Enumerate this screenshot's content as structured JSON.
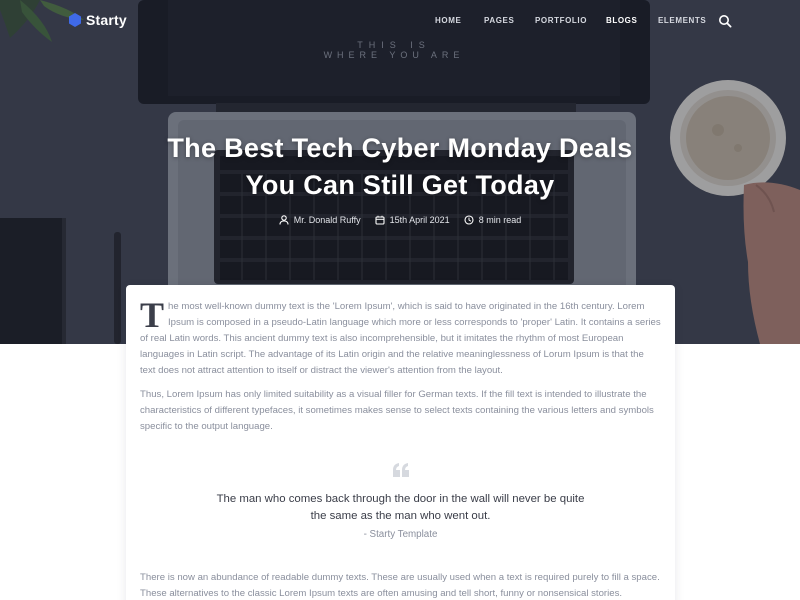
{
  "brand": {
    "name": "Starty",
    "accent": "#3f6ae8"
  },
  "nav": {
    "items": [
      {
        "label": "HOME",
        "active": false
      },
      {
        "label": "PAGES",
        "active": false
      },
      {
        "label": "PORTFOLIO",
        "active": false
      },
      {
        "label": "BLOGS",
        "active": true
      },
      {
        "label": "ELEMENTS",
        "active": false
      }
    ],
    "search_icon": "search-icon"
  },
  "hero": {
    "title_line1": "The Best Tech Cyber Monday Deals",
    "title_line2": "You Can Still Get Today",
    "screen_text_line1": "THIS IS",
    "screen_text_line2": "WHERE YOU ARE",
    "meta": {
      "author": "Mr. Donald Ruffy",
      "date": "15th April 2021",
      "read_time": "8 min read"
    }
  },
  "article": {
    "dropcap": "T",
    "p1_rest": "he most well-known dummy text is the 'Lorem Ipsum', which is said to have originated in the 16th century. Lorem Ipsum is composed in a pseudo-Latin language which more or less corresponds to 'proper' Latin. It contains a series of real Latin words. This ancient dummy text is also incomprehensible, but it imitates the rhythm of most European languages in Latin script. The advantage of its Latin origin and the relative meaninglessness of Lorum Ipsum is that the text does not attract attention to itself or distract the viewer's attention from the layout.",
    "p2": "Thus, Lorem Ipsum has only limited suitability as a visual filler for German texts. If the fill text is intended to illustrate the characteristics of different typefaces, it sometimes makes sense to select texts containing the various letters and symbols specific to the output language.",
    "quote": {
      "text": "The man who comes back through the door in the wall will never be quite the same as the man who went out.",
      "author": "- Starty Template"
    },
    "p3": "There is now an abundance of readable dummy texts. These are usually used when a text is required purely to fill a space. These alternatives to the classic Lorem Ipsum texts are often amusing and tell short, funny or nonsensical stories."
  }
}
